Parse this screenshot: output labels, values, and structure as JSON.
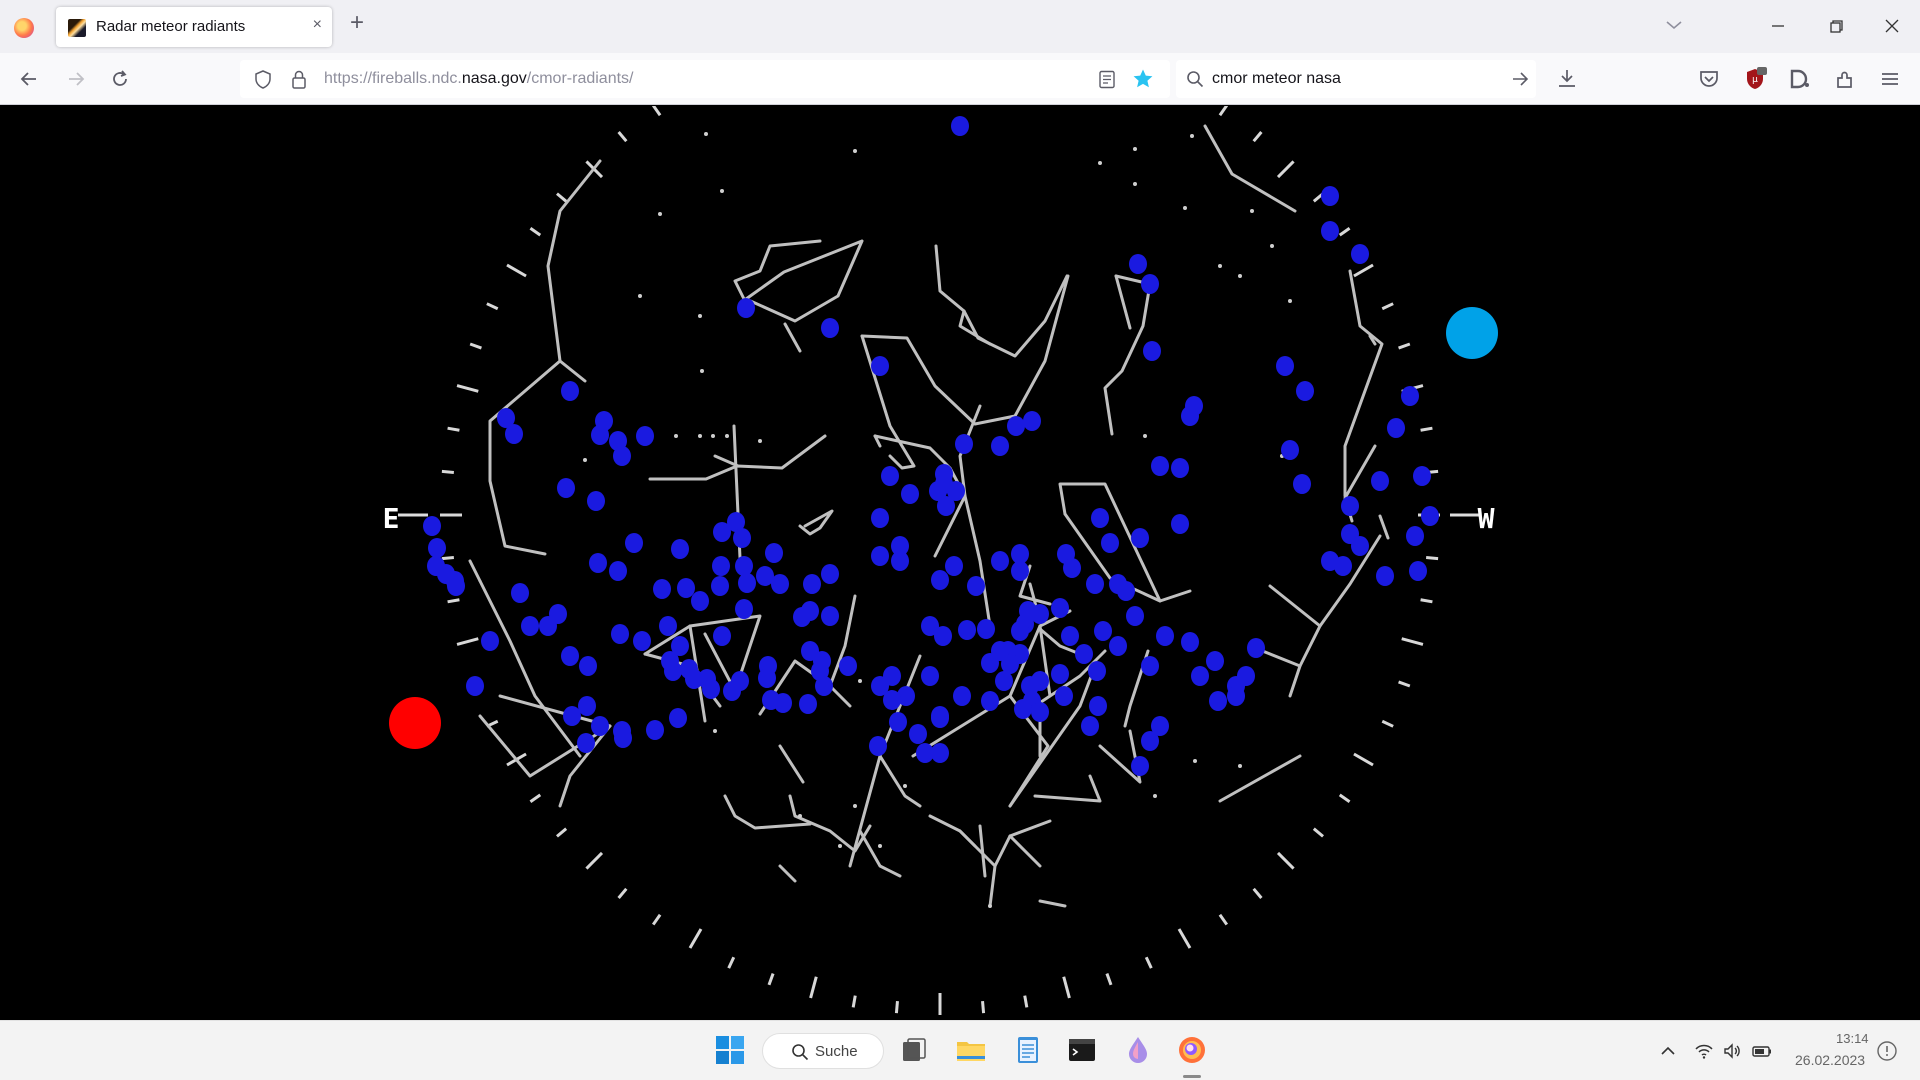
{
  "browser": {
    "tab_title": "Radar meteor radiants",
    "tab_close_glyph": "×",
    "new_tab_glyph": "+",
    "url_prefix": "https://fireballs.ndc.",
    "url_host": "nasa.gov",
    "url_suffix": "/cmor-radiants/",
    "search_query": "cmor meteor nasa",
    "bookmark_color": "#2ac3f1",
    "icons": [
      "firefox-menu-icon",
      "tab-list-icon",
      "minimize-icon",
      "restore-icon",
      "close-icon",
      "back-icon",
      "forward-icon",
      "reload-icon",
      "shield-icon",
      "lock-icon",
      "reader-mode-icon",
      "bookmark-star-icon",
      "search-icon",
      "search-go-icon",
      "downloads-icon",
      "pocket-icon",
      "ublock-icon",
      "extension-d-icon",
      "extensions-icon",
      "hamburger-menu-icon"
    ]
  },
  "sky_map": {
    "compass": {
      "east": "E",
      "west": "W"
    },
    "markers": {
      "sun_color": "#ff0000",
      "antisun_color": "#00a2e8"
    },
    "colors": {
      "radiant": "#1a1ae0",
      "constellation": "#c0c0c0",
      "background": "#000000"
    }
  },
  "taskbar": {
    "search_label": "Suche",
    "time": "13:14",
    "date": "26.02.2023",
    "apps": [
      "start-icon",
      "task-view-icon",
      "file-explorer-icon",
      "notepad-icon",
      "terminal-icon",
      "paint-drop-icon",
      "firefox-icon"
    ],
    "tray": [
      "chevron-up-icon",
      "wifi-icon",
      "volume-icon",
      "battery-icon",
      "notification-icon"
    ]
  }
}
